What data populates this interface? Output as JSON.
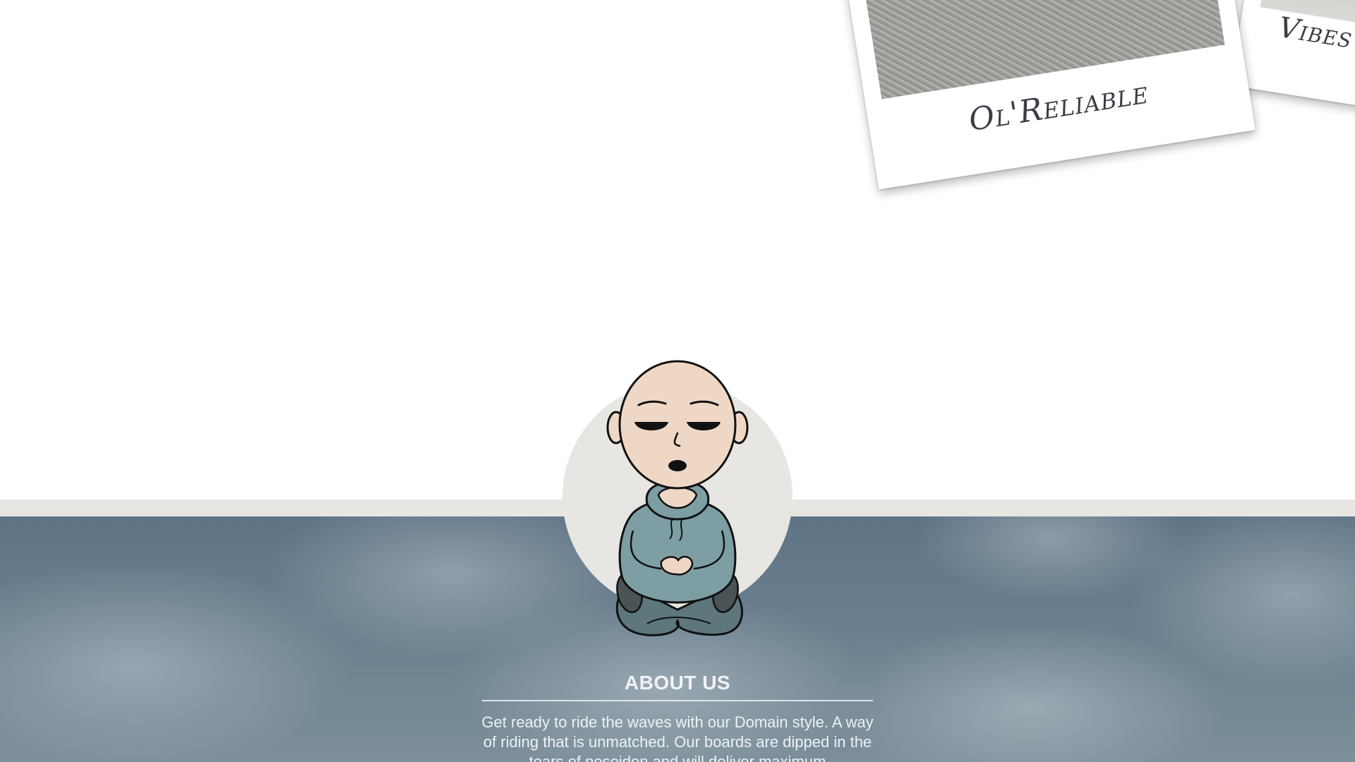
{
  "gallery": {
    "cards": [
      {
        "caption": "Ol'Reliable"
      },
      {
        "caption": "Vibes"
      }
    ]
  },
  "about": {
    "heading": "ABOUT US",
    "body": "Get ready to ride the waves with our Domain style. A way of riding that is unmatched. Our boards are dipped in the tears of poseidon and will deliver maximum"
  },
  "colors": {
    "band": "#e8e6e2",
    "sky": "#6a7f8e",
    "text_light": "#f1f3f4"
  },
  "icons": {
    "mascot": "meditating-surfer-mascot"
  }
}
